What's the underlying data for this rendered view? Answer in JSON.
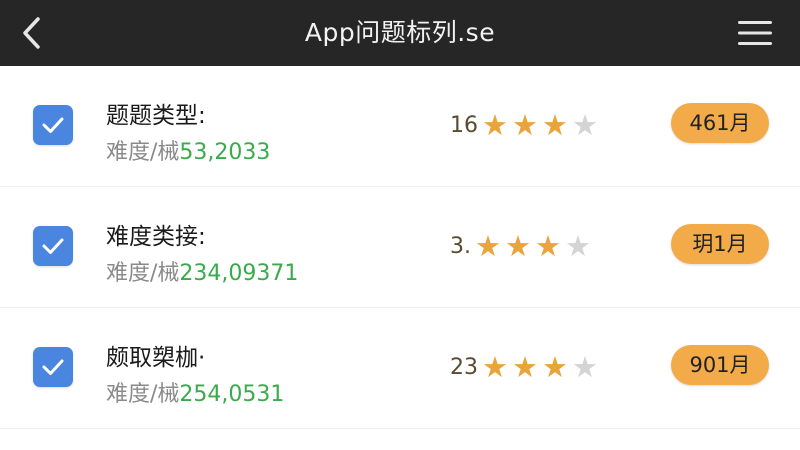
{
  "header": {
    "title": "App问题标列.se",
    "back_icon": "chevron-left-icon",
    "menu_icon": "hamburger-menu-icon",
    "background_color": "#262626"
  },
  "items": [
    {
      "name": "题题类型:",
      "sub_label": "难度/械",
      "sub_value": "53,2033",
      "rating_prefix": "16",
      "stars_filled": 3,
      "stars_total": 4,
      "badge": "461月",
      "checked": true
    },
    {
      "name": "难度类接:",
      "sub_label": "难度/械",
      "sub_value": "234,09371",
      "rating_prefix": "3.",
      "stars_filled": 3,
      "stars_total": 4,
      "badge": "玥1月",
      "checked": true
    },
    {
      "name": "颇取槊枷·",
      "sub_label": "难度/械",
      "sub_value": "254,0531",
      "rating_prefix": "23",
      "stars_filled": 3,
      "stars_total": 4,
      "badge": "901月",
      "checked": true
    }
  ],
  "colors": {
    "checkbox": "#4a86e0",
    "star_filled": "#e9a43a",
    "star_empty": "#d4d4d4",
    "badge": "#f2ab48",
    "value_text": "#3aaa4a"
  }
}
